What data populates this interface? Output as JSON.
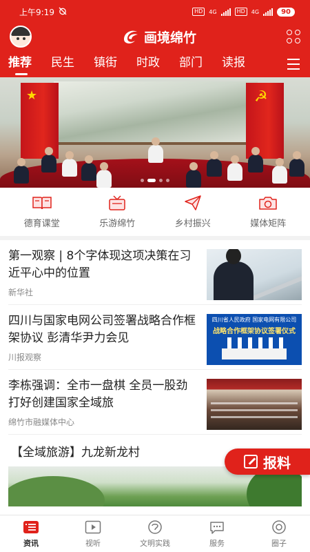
{
  "status_bar": {
    "time": "上午9:19",
    "alarm_icon": "alarm-off-icon",
    "hd_1": "HD",
    "net_1": "4G",
    "hd_2": "HD",
    "net_2": "4G",
    "battery": "90"
  },
  "app_bar": {
    "title": "画境绵竹",
    "avatar_icon": "user-avatar",
    "grid_icon": "apps-grid-icon"
  },
  "tabs": [
    {
      "label": "推荐",
      "active": true
    },
    {
      "label": "民生"
    },
    {
      "label": "镇街"
    },
    {
      "label": "时政"
    },
    {
      "label": "部门"
    },
    {
      "label": "读报"
    }
  ],
  "shortcuts": [
    {
      "label": "德育课堂",
      "icon": "open-book-icon"
    },
    {
      "label": "乐游绵竹",
      "icon": "tv-icon"
    },
    {
      "label": "乡村振兴",
      "icon": "paper-plane-icon"
    },
    {
      "label": "媒体矩阵",
      "icon": "camera-icon"
    }
  ],
  "news": [
    {
      "title": "第一观察 | 8个字体现这项决策在习近平心中的位置",
      "source": "新华社"
    },
    {
      "title": "四川与国家电网公司签署战略合作框架协议 彭清华尹力会见",
      "source": "川报观察",
      "thumb_header": "四川省人民政府     国家电网有限公司",
      "thumb_banner": "战略合作框架协议签署仪式"
    },
    {
      "title": "李栋强调：全市一盘棋 全员一股劲 打好创建国家全域旅",
      "source": "绵竹市融媒体中心"
    }
  ],
  "section": {
    "title": "【全域旅游】九龙新龙村"
  },
  "report_button": {
    "label": "报料",
    "icon": "edit-icon"
  },
  "bottom_nav": [
    {
      "label": "资讯",
      "icon": "news-icon",
      "active": true
    },
    {
      "label": "视听",
      "icon": "play-icon"
    },
    {
      "label": "文明实践",
      "icon": "civilization-icon"
    },
    {
      "label": "服务",
      "icon": "chat-icon"
    },
    {
      "label": "圈子",
      "icon": "circle-icon"
    }
  ],
  "colors": {
    "brand_red": "#e0221b",
    "text": "#222222",
    "muted": "#888888"
  }
}
